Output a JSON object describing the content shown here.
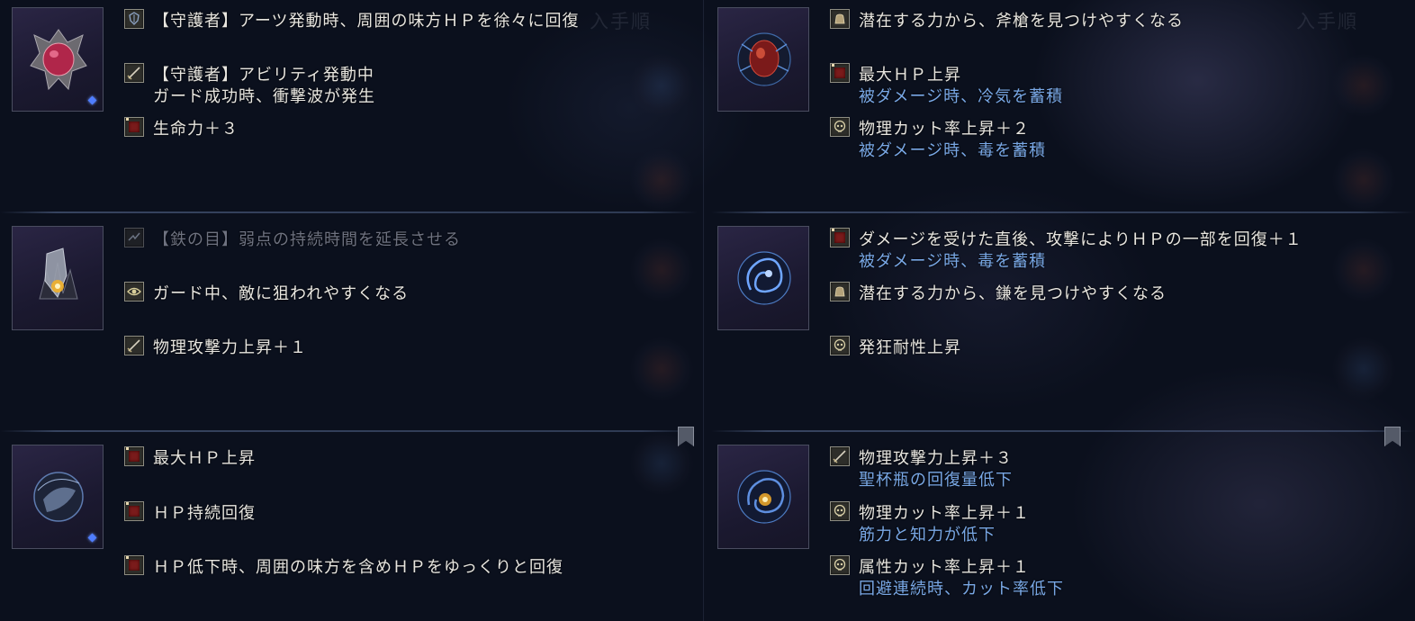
{
  "icons": {
    "shield_icon": "shield-icon",
    "sword_icon": "sword-icon",
    "vitality_icon": "red-vitality-icon",
    "eye_icon": "eye-icon",
    "bag_icon": "item-bag-icon",
    "skull_icon": "skull-icon"
  },
  "left": {
    "relics": [
      {
        "effects": [
          "【守護者】アーツ発動時、周囲の味方ＨＰを徐々に回復",
          "【守護者】アビリティ発動中",
          "ガード成功時、衝撃波が発生",
          "生命力＋３"
        ]
      },
      {
        "effects": [
          "【鉄の目】弱点の持続時間を延長させる",
          "ガード中、敵に狙われやすくなる",
          "物理攻撃力上昇＋１"
        ]
      },
      {
        "effects": [
          "最大ＨＰ上昇",
          "ＨＰ持続回復",
          "ＨＰ低下時、周囲の味方を含めＨＰをゆっくりと回復"
        ]
      }
    ]
  },
  "right": {
    "relics": [
      {
        "effects": [
          "潜在する力から、斧槍を見つけやすくなる",
          "最大ＨＰ上昇",
          "被ダメージ時、冷気を蓄積",
          "物理カット率上昇＋２",
          "被ダメージ時、毒を蓄積"
        ]
      },
      {
        "effects": [
          "ダメージを受けた直後、攻撃によりＨＰの一部を回復＋１",
          "被ダメージ時、毒を蓄積",
          "潜在する力から、鎌を見つけやすくなる",
          "発狂耐性上昇"
        ]
      },
      {
        "effects": [
          "物理攻撃力上昇＋３",
          "聖杯瓶の回復量低下",
          "物理カット率上昇＋１",
          "筋力と知力が低下",
          "属性カット率上昇＋１",
          "回避連続時、カット率低下"
        ]
      }
    ]
  },
  "ghost_text": "入手順",
  "colors": {
    "background": "#0b101d",
    "text": "#e8e6e0",
    "negative_effect": "#79a8e6",
    "disabled_effect": "#6e7280",
    "accent_diamond": "#4f7dff"
  }
}
